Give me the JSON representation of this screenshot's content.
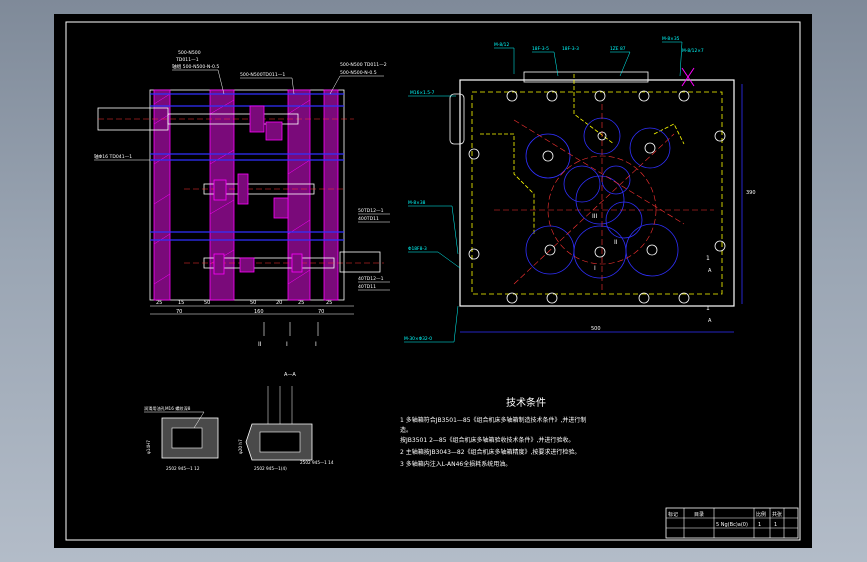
{
  "drawing": {
    "left_view": {
      "labels": {
        "top_a": "500-N500",
        "top_b": "TD011—1",
        "top_c": "轴组 500-N500-N-0.5",
        "mid_a": "500-N500TD011—1",
        "right_a": "500-N500 TD011—2",
        "right_b": "500-N500-N-0.5",
        "left_a": "轴Φ16 TD041—1",
        "r1": "50TD12—1",
        "r2": "400TD11",
        "r3": "40TD12—1",
        "r4": "40TD11"
      },
      "dims": [
        "25",
        "15",
        "50",
        "50",
        "20",
        "25",
        "25",
        "70",
        "160",
        "70"
      ],
      "roman": [
        "II",
        "I",
        "I"
      ]
    },
    "right_view": {
      "top_labels": [
        "M-8/12",
        "18F-3-5",
        "18F-3-3",
        "1ZE 87",
        "M-8×35",
        "M-8/12×7"
      ],
      "left_labels": [
        "M16×1.5-7",
        "M-8×38",
        "Φ18F8-3",
        "M-30×Φ32-0"
      ],
      "ref_labels": [
        "III",
        "II",
        "I",
        "1",
        "1"
      ],
      "dims": [
        "500",
        "390",
        "A",
        "A"
      ]
    },
    "detail_view": {
      "section_label": "A—A",
      "labels": [
        "润滑用油孔M16 螺纹深8",
        "2502 945—1 12",
        "2502 945—1(4)",
        "2502 945—1 14",
        "φ14H7",
        "φ20 h7"
      ]
    },
    "tech": {
      "title": "技术条件",
      "lines": [
        "1 多轴箱符合JB3501—85《组合机床多轴箱制造技术条件》,并进行制",
        "造。",
        "  按JB3501 2—85《组合机床多轴箱验收技术条件》,并进行验收。",
        "2 主轴箱按JB3043—82《组合机床多轴箱精度》,按要求进行检验。",
        "3 多轴箱内注入L-AN46全损耗系统用油。"
      ]
    },
    "title_block": {
      "cells": [
        "标记",
        "目录",
        "5 Ng(Bc)a(0)",
        "比例",
        "共张"
      ],
      "numbers": [
        "1",
        "1"
      ]
    }
  },
  "colors": {
    "background": "#000000",
    "outline": "#ffffff",
    "magenta": "#ff00ff",
    "blue": "#0000ff",
    "yellow": "#ffff00",
    "red": "#ff3333",
    "cyan": "#00ffff",
    "grey": "#8c8c8c"
  }
}
